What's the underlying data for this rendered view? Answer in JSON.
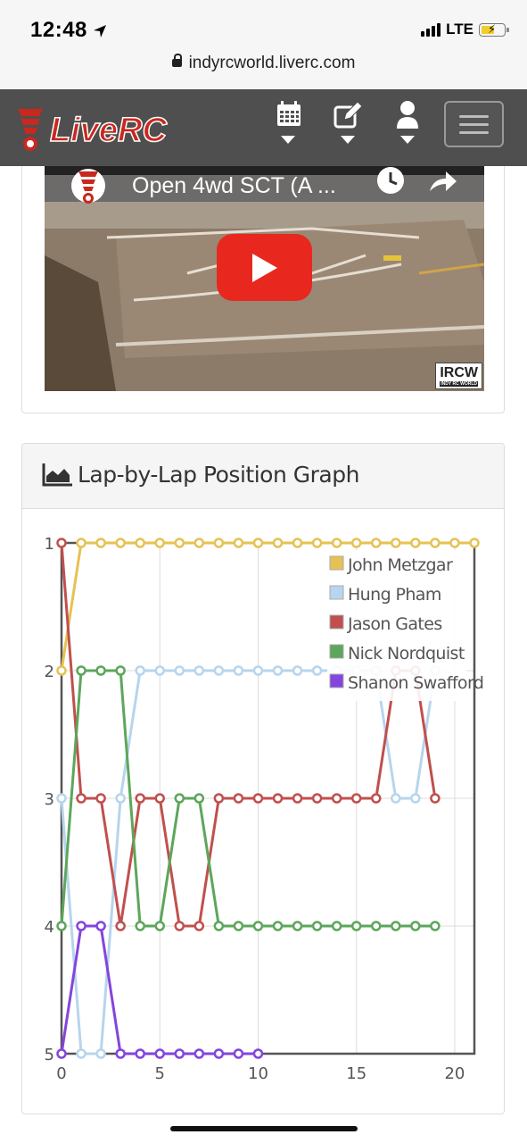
{
  "status_bar": {
    "time": "12:48",
    "network": "LTE"
  },
  "browser": {
    "url": "indyrcworld.liverc.com"
  },
  "navbar": {
    "logo_text": "LiveRC",
    "icons": [
      "calendar-icon",
      "edit-icon",
      "user-icon",
      "menu-icon"
    ]
  },
  "video": {
    "title": "Open 4wd SCT (A ...",
    "watermark": "IRCW",
    "watermark_sub": "INDY RC WORLD"
  },
  "graph_panel": {
    "heading": "Lap-by-Lap Position Graph"
  },
  "chart_data": {
    "type": "line",
    "title": "",
    "xlabel": "",
    "ylabel": "",
    "xlim": [
      0,
      21
    ],
    "ylim": [
      1,
      5
    ],
    "y_inverted": true,
    "x_ticks": [
      "0",
      "5",
      "10",
      "15",
      "20"
    ],
    "y_ticks": [
      "1",
      "2",
      "3",
      "4",
      "5"
    ],
    "grid": true,
    "legend_position": "top-right",
    "series": [
      {
        "name": "John Metzgar",
        "color": "#e5c253",
        "x": [
          0,
          1,
          2,
          3,
          4,
          5,
          6,
          7,
          8,
          9,
          10,
          11,
          12,
          13,
          14,
          15,
          16,
          17,
          18,
          19,
          20,
          21
        ],
        "values": [
          2,
          1,
          1,
          1,
          1,
          1,
          1,
          1,
          1,
          1,
          1,
          1,
          1,
          1,
          1,
          1,
          1,
          1,
          1,
          1,
          1,
          1
        ]
      },
      {
        "name": "Hung Pham",
        "color": "#b7d5ee",
        "x": [
          0,
          1,
          2,
          3,
          4,
          5,
          6,
          7,
          8,
          9,
          10,
          11,
          12,
          13,
          14,
          15,
          16,
          17,
          18,
          19
        ],
        "values": [
          3,
          5,
          5,
          3,
          2,
          2,
          2,
          2,
          2,
          2,
          2,
          2,
          2,
          2,
          2,
          2,
          2,
          3,
          3,
          2
        ]
      },
      {
        "name": "Jason Gates",
        "color": "#c0504d",
        "x": [
          0,
          1,
          2,
          3,
          4,
          5,
          6,
          7,
          8,
          9,
          10,
          11,
          12,
          13,
          14,
          15,
          16,
          17,
          18,
          19
        ],
        "values": [
          1,
          3,
          3,
          4,
          3,
          3,
          4,
          4,
          3,
          3,
          3,
          3,
          3,
          3,
          3,
          3,
          3,
          2,
          2,
          3
        ]
      },
      {
        "name": "Nick Nordquist",
        "color": "#5da65b",
        "x": [
          0,
          1,
          2,
          3,
          4,
          5,
          6,
          7,
          8,
          9,
          10,
          11,
          12,
          13,
          14,
          15,
          16,
          17,
          18,
          19
        ],
        "values": [
          4,
          2,
          2,
          2,
          4,
          4,
          3,
          3,
          4,
          4,
          4,
          4,
          4,
          4,
          4,
          4,
          4,
          4,
          4,
          4
        ]
      },
      {
        "name": "Shanon Swafford",
        "color": "#8445de",
        "x": [
          0,
          1,
          2,
          3,
          4,
          5,
          6,
          7,
          8,
          9,
          10
        ],
        "values": [
          5,
          4,
          4,
          5,
          5,
          5,
          5,
          5,
          5,
          5,
          5
        ]
      }
    ]
  }
}
